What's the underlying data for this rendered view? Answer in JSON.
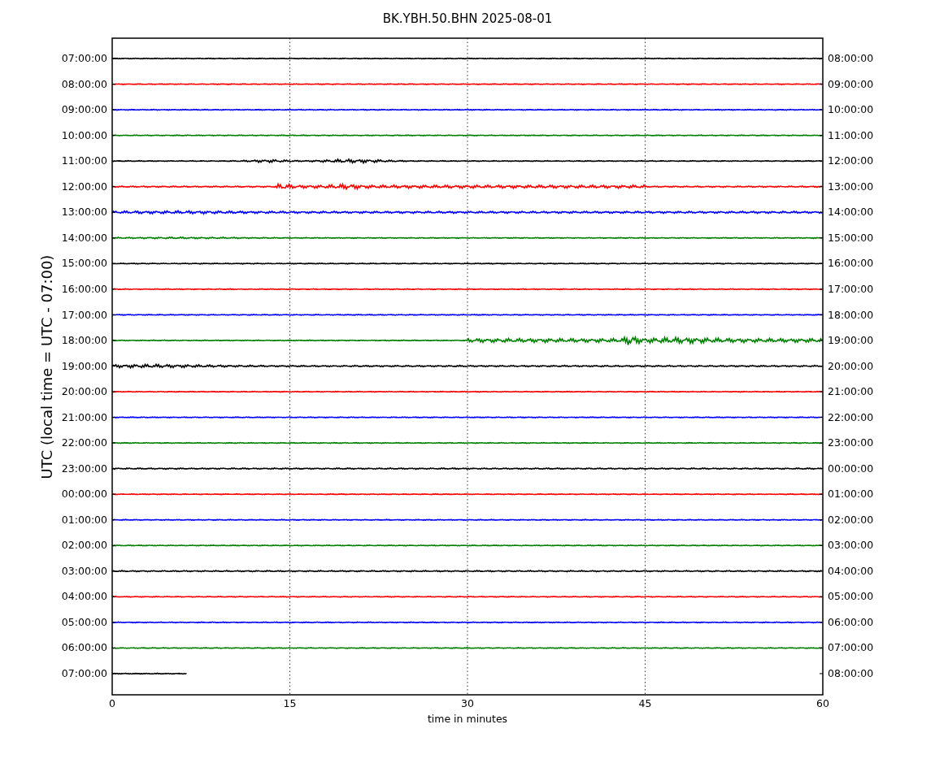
{
  "title": "BK.YBH.50.BHN 2025-08-01",
  "ylabel": "UTC (local time = UTC - 07:00)",
  "xlabel": "time in minutes",
  "xticks": [
    "0",
    "15",
    "30",
    "45",
    "60"
  ],
  "rows": [
    {
      "left": "07:00:00",
      "right": "08:00:00",
      "color": "#000000"
    },
    {
      "left": "08:00:00",
      "right": "09:00:00",
      "color": "#ff0000"
    },
    {
      "left": "09:00:00",
      "right": "10:00:00",
      "color": "#0000ff"
    },
    {
      "left": "10:00:00",
      "right": "11:00:00",
      "color": "#008000"
    },
    {
      "left": "11:00:00",
      "right": "12:00:00",
      "color": "#000000"
    },
    {
      "left": "12:00:00",
      "right": "13:00:00",
      "color": "#ff0000"
    },
    {
      "left": "13:00:00",
      "right": "14:00:00",
      "color": "#0000ff"
    },
    {
      "left": "14:00:00",
      "right": "15:00:00",
      "color": "#008000"
    },
    {
      "left": "15:00:00",
      "right": "16:00:00",
      "color": "#000000"
    },
    {
      "left": "16:00:00",
      "right": "17:00:00",
      "color": "#ff0000"
    },
    {
      "left": "17:00:00",
      "right": "18:00:00",
      "color": "#0000ff"
    },
    {
      "left": "18:00:00",
      "right": "19:00:00",
      "color": "#008000"
    },
    {
      "left": "19:00:00",
      "right": "20:00:00",
      "color": "#000000"
    },
    {
      "left": "20:00:00",
      "right": "21:00:00",
      "color": "#ff0000"
    },
    {
      "left": "21:00:00",
      "right": "22:00:00",
      "color": "#0000ff"
    },
    {
      "left": "22:00:00",
      "right": "23:00:00",
      "color": "#008000"
    },
    {
      "left": "23:00:00",
      "right": "00:00:00",
      "color": "#000000"
    },
    {
      "left": "00:00:00",
      "right": "01:00:00",
      "color": "#ff0000"
    },
    {
      "left": "01:00:00",
      "right": "02:00:00",
      "color": "#0000ff"
    },
    {
      "left": "02:00:00",
      "right": "03:00:00",
      "color": "#008000"
    },
    {
      "left": "03:00:00",
      "right": "04:00:00",
      "color": "#000000"
    },
    {
      "left": "04:00:00",
      "right": "05:00:00",
      "color": "#ff0000"
    },
    {
      "left": "05:00:00",
      "right": "06:00:00",
      "color": "#0000ff"
    },
    {
      "left": "06:00:00",
      "right": "07:00:00",
      "color": "#008000"
    },
    {
      "left": "07:00:00",
      "right": "08:00:00",
      "color": "#000000"
    }
  ]
}
